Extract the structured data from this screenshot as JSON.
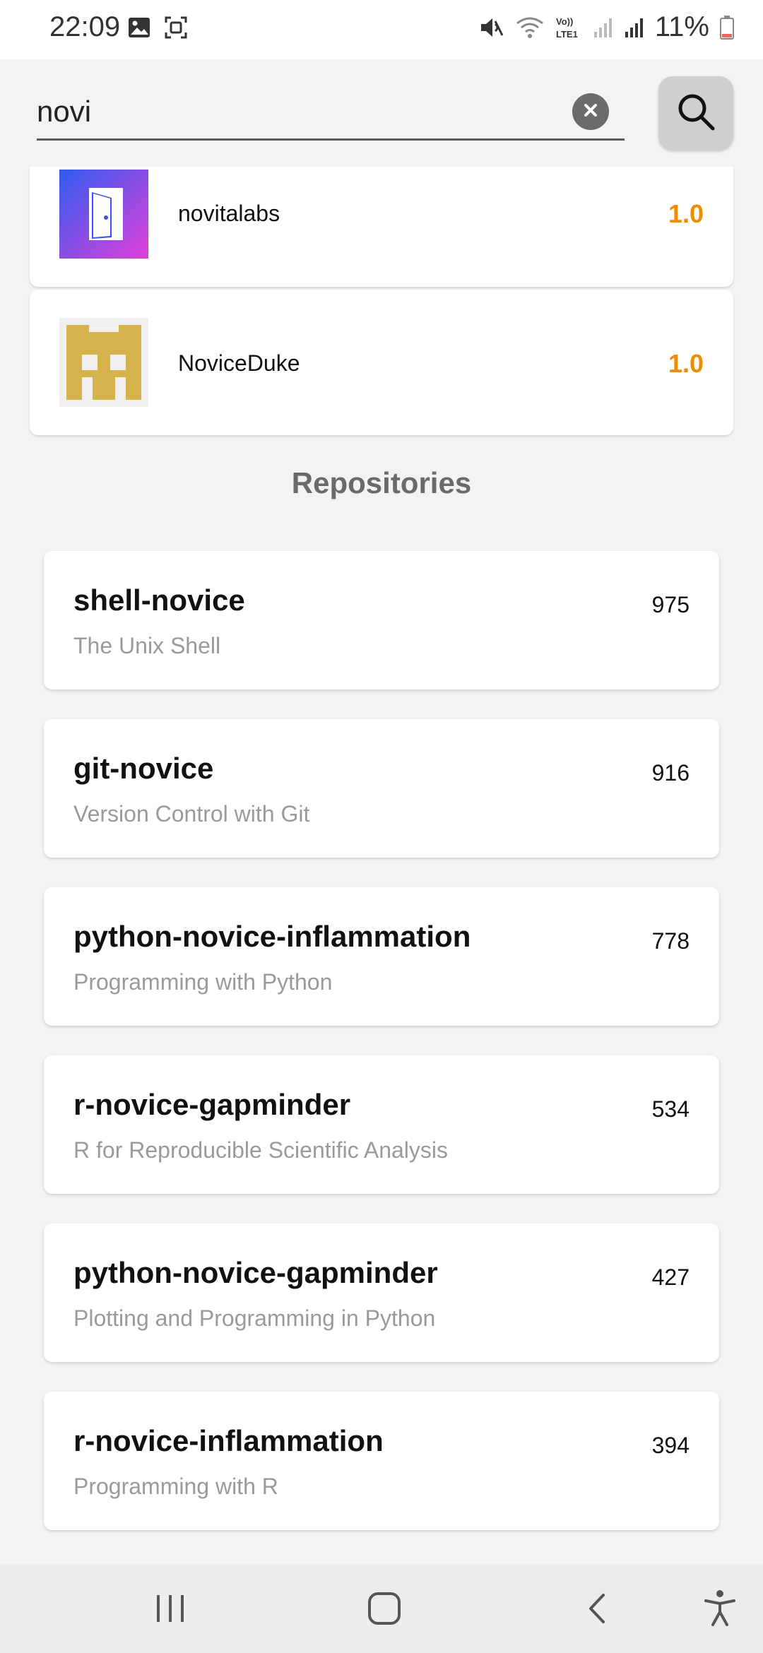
{
  "status_bar": {
    "time": "22:09",
    "battery": "11%",
    "icons": [
      "image-icon",
      "screenshot-icon",
      "mute-icon",
      "wifi-icon",
      "volte-icon",
      "signal-icon",
      "signal-icon",
      "battery-icon"
    ]
  },
  "search": {
    "value": "novi",
    "clear_icon": "close-icon",
    "button_icon": "search-icon"
  },
  "users": [
    {
      "name": "novitalabs",
      "score": "1.0",
      "avatar": "door-logo"
    },
    {
      "name": "NoviceDuke",
      "score": "1.0",
      "avatar": "pixel-avatar"
    }
  ],
  "repositories_title": "Repositories",
  "repositories": [
    {
      "name": "shell-novice",
      "description": "The Unix Shell",
      "stars": "975"
    },
    {
      "name": "git-novice",
      "description": "Version Control with Git",
      "stars": "916"
    },
    {
      "name": "python-novice-inflammation",
      "description": "Programming with Python",
      "stars": "778"
    },
    {
      "name": "r-novice-gapminder",
      "description": "R for Reproducible Scientific Analysis",
      "stars": "534"
    },
    {
      "name": "python-novice-gapminder",
      "description": "Plotting and Programming in Python",
      "stars": "427"
    },
    {
      "name": "r-novice-inflammation",
      "description": "Programming with R",
      "stars": "394"
    }
  ],
  "colors": {
    "score": "#f08c00",
    "avatar_gradient_start": "#2f5cf0",
    "avatar_gradient_end": "#e040d8",
    "pixel_avatar": "#d4b24c"
  },
  "nav": [
    "recent-apps-icon",
    "home-icon",
    "back-icon",
    "accessibility-icon"
  ]
}
